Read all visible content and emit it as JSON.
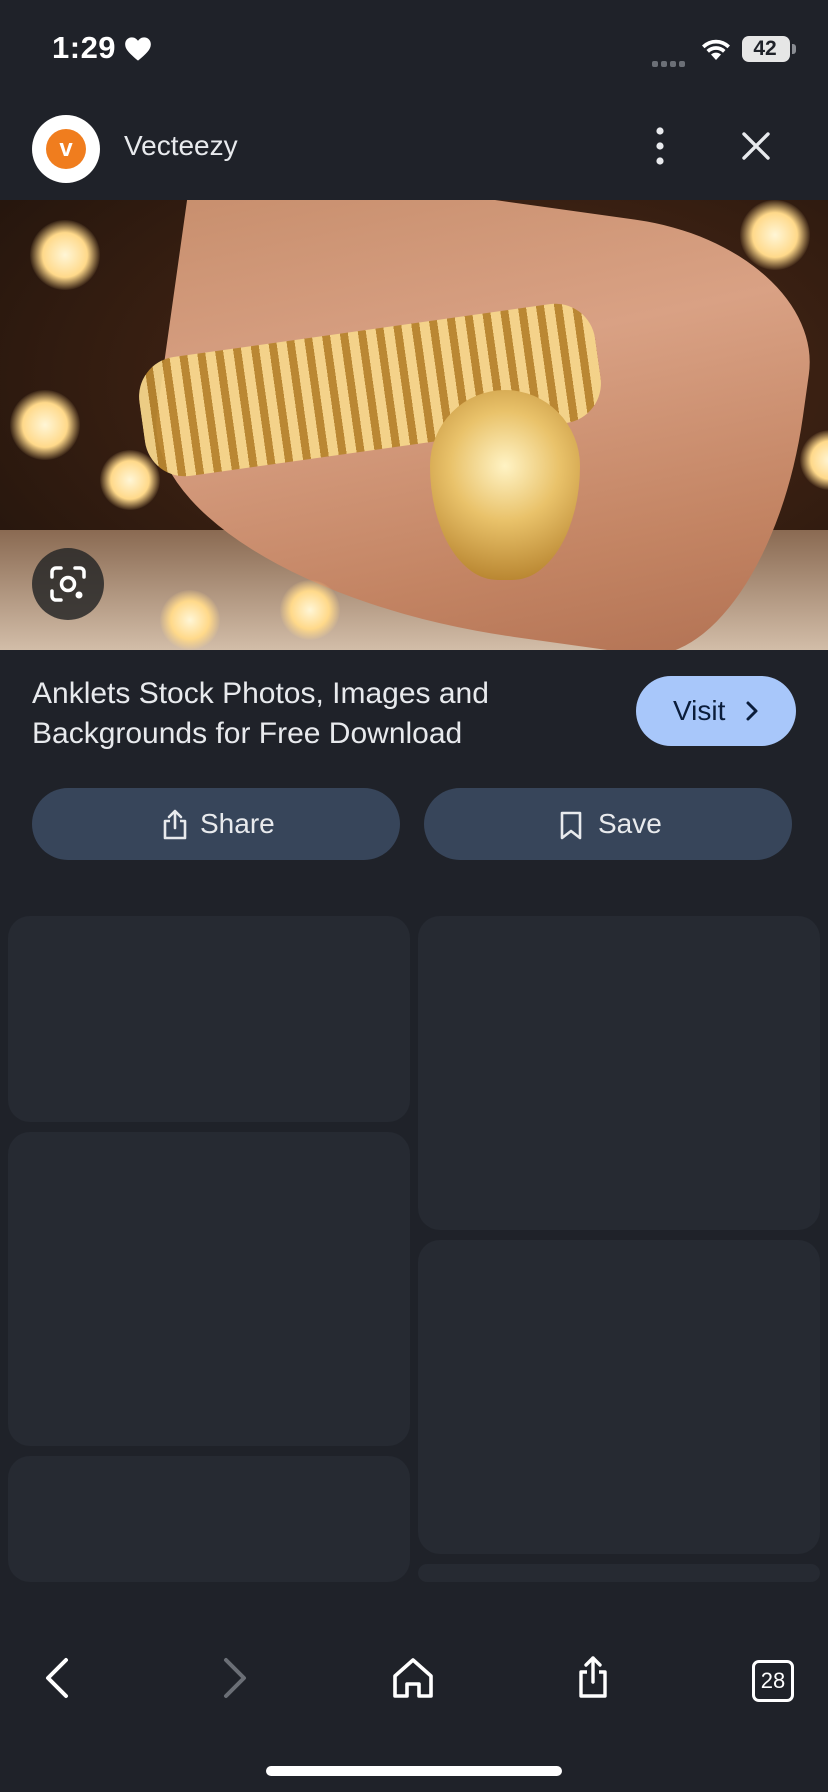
{
  "status_bar": {
    "time": "1:29",
    "battery": "42"
  },
  "header": {
    "site_name": "Vecteezy"
  },
  "result": {
    "title": "Anklets Stock Photos, Images and Backgrounds for Free Download",
    "visit_label": "Visit"
  },
  "actions": {
    "share_label": "Share",
    "save_label": "Save"
  },
  "toolbar": {
    "tab_count": "28"
  },
  "colors": {
    "accent": "#a8c7fa",
    "background": "#1f2229",
    "button": "#37455a",
    "brand": "#f07d1e"
  }
}
